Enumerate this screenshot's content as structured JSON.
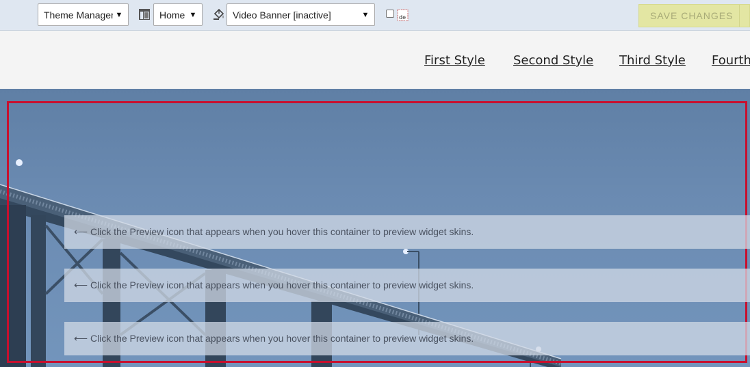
{
  "toolbar": {
    "theme_select": "Theme Manager",
    "page_select": "Home",
    "widget_select": "Video Banner [inactive]",
    "save_label": "SAVE CHANGES",
    "icons": [
      "layout-icon",
      "paint-bucket-icon",
      "broken-image-icon"
    ]
  },
  "nav": {
    "items": [
      "First Style",
      "Second Style",
      "Third Style",
      "Fourth"
    ]
  },
  "hero": {
    "messages": [
      "⟵ Click the Preview icon that appears when you hover this container to preview widget skins.",
      "⟵ Click the Preview icon that appears when you hover this container to preview widget skins.",
      "⟵ Click the Preview icon that appears when you hover this container to preview widget skins."
    ],
    "frame_color": "#c8102e"
  }
}
